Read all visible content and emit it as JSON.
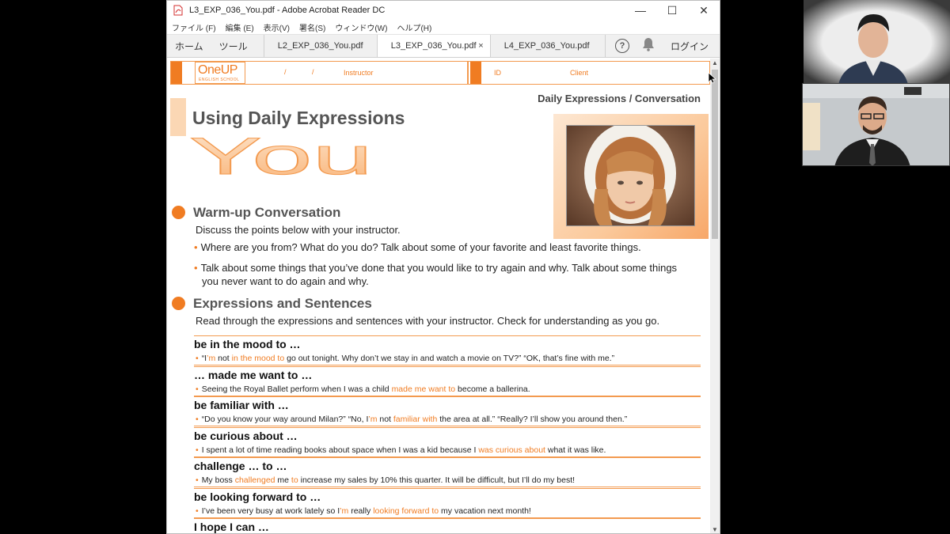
{
  "window": {
    "title": "L3_EXP_036_You.pdf - Adobe Acrobat Reader DC",
    "minimize": "—",
    "maximize": "☐",
    "close": "✕"
  },
  "menu": [
    "ファイル (F)",
    "編集 (E)",
    "表示(V)",
    "署名(S)",
    "ウィンドウ(W)",
    "ヘルプ(H)"
  ],
  "nav": {
    "home": "ホーム",
    "tools": "ツール",
    "login": "ログイン",
    "help": "?"
  },
  "tabs": [
    {
      "label": "L2_EXP_036_You.pdf"
    },
    {
      "label": "L3_EXP_036_You.pdf",
      "close": "×"
    },
    {
      "label": "L4_EXP_036_You.pdf"
    }
  ],
  "doc": {
    "header": {
      "logo_main": "OneUP",
      "logo_sub": "ENGLISH SCHOOL",
      "slash1": "/",
      "slash2": "/",
      "instructor": "Instructor",
      "id": "ID",
      "client": "Client"
    },
    "category": "Daily Expressions / Conversation",
    "title": "Using Daily Expressions",
    "big_word": "You",
    "warmup": {
      "title": "Warm-up Conversation",
      "intro": "Discuss the points below with your instructor.",
      "bullets": [
        "Where are you from? What do you do? Talk about some of your favorite and least favorite things.",
        "Talk about some things that you’ve done that you would like to try again and why. Talk about some things you never want to do again and why."
      ]
    },
    "expressions": {
      "title": "Expressions and Sentences",
      "intro": "Read through the expressions and sentences with your instructor. Check for understanding as you go.",
      "items": [
        {
          "title": "be in the mood to …",
          "ex": [
            {
              "t": "“I"
            },
            {
              "t": "’m",
              "h": true
            },
            {
              "t": " not "
            },
            {
              "t": "in the mood to",
              "h": true
            },
            {
              "t": " go out tonight. Why don’t we stay in and watch a movie on TV?”  “OK, that’s fine with me.”"
            }
          ]
        },
        {
          "title": "… made me want to …",
          "ex": [
            {
              "t": "Seeing the Royal Ballet perform when I was a child "
            },
            {
              "t": "made me want to",
              "h": true
            },
            {
              "t": " become a ballerina."
            }
          ]
        },
        {
          "title": "be familiar with …",
          "ex": [
            {
              "t": "“Do you know your way around Milan?”  “No, I"
            },
            {
              "t": "’m",
              "h": true
            },
            {
              "t": " not "
            },
            {
              "t": "familiar with",
              "h": true
            },
            {
              "t": " the area at all.”  “Really? I’ll show you around then.”"
            }
          ]
        },
        {
          "title": "be curious about …",
          "ex": [
            {
              "t": "I spent a lot of time reading books about space when I was a kid because I "
            },
            {
              "t": "was curious about",
              "h": true
            },
            {
              "t": " what it was like."
            }
          ]
        },
        {
          "title": "challenge … to …",
          "ex": [
            {
              "t": "My boss "
            },
            {
              "t": "challenged",
              "h": true
            },
            {
              "t": " me "
            },
            {
              "t": "to",
              "h": true
            },
            {
              "t": " increase my sales by 10% this quarter. It will be difficult, but I’ll do my best!"
            }
          ]
        },
        {
          "title": "be looking forward to …",
          "ex": [
            {
              "t": "I’ve been very busy at work lately so I"
            },
            {
              "t": "’m",
              "h": true
            },
            {
              "t": " really "
            },
            {
              "t": "looking forward to",
              "h": true
            },
            {
              "t": " my vacation next month!"
            }
          ]
        },
        {
          "title": "I hope I can …",
          "ex": []
        }
      ]
    }
  },
  "colors": {
    "accent": "#f07c22",
    "accent_light": "#fbd7b4"
  }
}
